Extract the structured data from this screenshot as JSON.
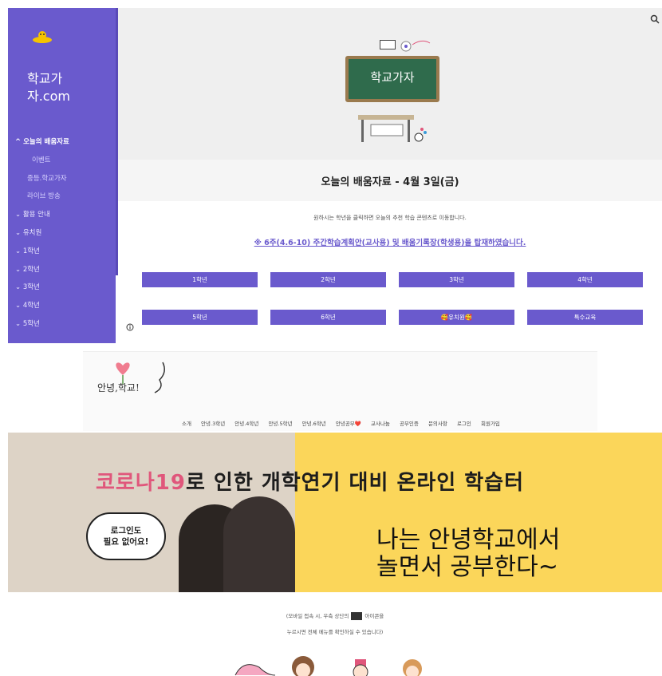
{
  "site1": {
    "name": "학교가자.com",
    "board_title": "학교가자",
    "sidebar": [
      {
        "label": "오늘의 배움자료",
        "icon": "chevron-up-icon",
        "level": "open"
      },
      {
        "label": "이벤트",
        "level": "sub"
      },
      {
        "label": "중등.학교가자",
        "level": "child"
      },
      {
        "label": "라이브 방송",
        "level": "child"
      },
      {
        "label": "활용 안내",
        "icon": "chevron-down-icon"
      },
      {
        "label": "유치원",
        "icon": "chevron-down-icon"
      },
      {
        "label": "1학년",
        "icon": "chevron-down-icon"
      },
      {
        "label": "2학년",
        "icon": "chevron-down-icon"
      },
      {
        "label": "3학년",
        "icon": "chevron-down-icon"
      },
      {
        "label": "4학년",
        "icon": "chevron-down-icon"
      },
      {
        "label": "5학년",
        "icon": "chevron-down-icon"
      }
    ],
    "page_title": "오늘의 배움자료 - 4월 3일(금)",
    "notice": "원하시는 학년을 클릭하면 오늘의 추천 학습 콘텐츠로 이동합니다.",
    "notice_link": "※ 6주(4.6-10) 주간학습계획안(교사용) 및 배움기록장(학생용)을 탑재하였습니다.",
    "grades": [
      "1학년",
      "2학년",
      "3학년",
      "4학년",
      "5학년",
      "6학년",
      "🥰유치원🥰",
      "특수교육"
    ],
    "accent_color": "#6a5acd"
  },
  "site2": {
    "logo_text": "안녕,학교!",
    "nav": [
      "소개",
      "안녕.3학년",
      "안녕.4학년",
      "안녕.5학년",
      "안녕.6학년",
      "안녕공부❤️",
      "교사나눔",
      "공부인증",
      "문의사항",
      "로그인",
      "회원가입"
    ],
    "banner_title_highlight": "코로나19",
    "banner_title_rest": "로 인한 개학연기 대비 온라인 학습터",
    "banner_sub_line1": "나는 안녕학교에서",
    "banner_sub_line2": "놀면서 공부한다~",
    "bubble_line1": "로그인도",
    "bubble_line2": "필요 없어요!",
    "mobile_note_before": "(모바일 접속 시, 우측 상단의",
    "mobile_note_after": "아이콘을",
    "mobile_note_line2": "누르시면 전체 메뉴를 확인하실 수 있습니다)"
  }
}
